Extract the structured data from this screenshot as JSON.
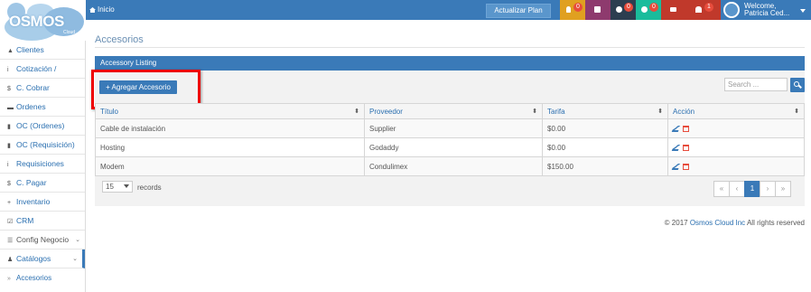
{
  "logo": {
    "text": "OSMOS",
    "sub": "Cloud"
  },
  "topbar": {
    "home_label": "Inicio",
    "plan_button": "Actualizar Plan",
    "icons": [
      {
        "name": "lightbulb-icon",
        "color": "#e0a020",
        "count": "0"
      },
      {
        "name": "calendar-icon",
        "color": "#8e3a6e",
        "count": ""
      },
      {
        "name": "info-icon",
        "color": "#2c3e50",
        "count": "0"
      },
      {
        "name": "comment-icon",
        "color": "#1abc9c",
        "count": "0"
      },
      {
        "name": "envelope-icon",
        "color": "#c0392b",
        "count": ""
      },
      {
        "name": "bell-icon",
        "color": "#c0392b",
        "count": "1"
      }
    ],
    "welcome_line1": "Welcome,",
    "welcome_line2": "Patricia Ced..."
  },
  "sidebar": {
    "items": [
      {
        "label": "Clientes",
        "icon": "user-icon",
        "glyph": "▲"
      },
      {
        "label": "Cotización /",
        "icon": "info-icon",
        "glyph": "i"
      },
      {
        "label": "C. Cobrar",
        "icon": "dollar-icon",
        "glyph": "$"
      },
      {
        "label": "Ordenes",
        "icon": "cart-icon",
        "glyph": "▬"
      },
      {
        "label": "OC (Ordenes)",
        "icon": "file-icon",
        "glyph": "▮"
      },
      {
        "label": "OC (Requisición)",
        "icon": "file-icon",
        "glyph": "▮"
      },
      {
        "label": "Requisiciones",
        "icon": "info-icon",
        "glyph": "i"
      },
      {
        "label": "C. Pagar",
        "icon": "dollar-icon",
        "glyph": "$"
      },
      {
        "label": "Inventario",
        "icon": "plus-icon",
        "glyph": "+"
      },
      {
        "label": "CRM",
        "icon": "check-icon",
        "glyph": "☑"
      },
      {
        "label": "Config Negocio",
        "icon": "list-icon",
        "glyph": "☰"
      },
      {
        "label": "Catálogos",
        "icon": "users-icon",
        "glyph": "♟"
      }
    ],
    "sub_item": "Accesorios"
  },
  "page": {
    "title": "Accesorios",
    "panel_title": "Accessory Listing",
    "add_button": "+ Agregar Accesorio",
    "search_placeholder": "Search ..."
  },
  "table": {
    "columns": [
      "Título",
      "Proveedor",
      "Tarifa",
      "Acción"
    ],
    "rows": [
      {
        "titulo": "Cable de instalación",
        "proveedor": "Supplier",
        "tarifa": "$0.00"
      },
      {
        "titulo": "Hosting",
        "proveedor": "Godaddy",
        "tarifa": "$0.00"
      },
      {
        "titulo": "Modem",
        "proveedor": "Condulimex",
        "tarifa": "$150.00"
      }
    ]
  },
  "pager": {
    "page_size": "15",
    "records_label": "records",
    "buttons": [
      "«",
      "‹",
      "1",
      "›",
      "»"
    ],
    "current_page": "1"
  },
  "footer": {
    "prefix": "© 2017",
    "company": "Osmos Cloud Inc",
    "suffix": "All rights reserved"
  }
}
